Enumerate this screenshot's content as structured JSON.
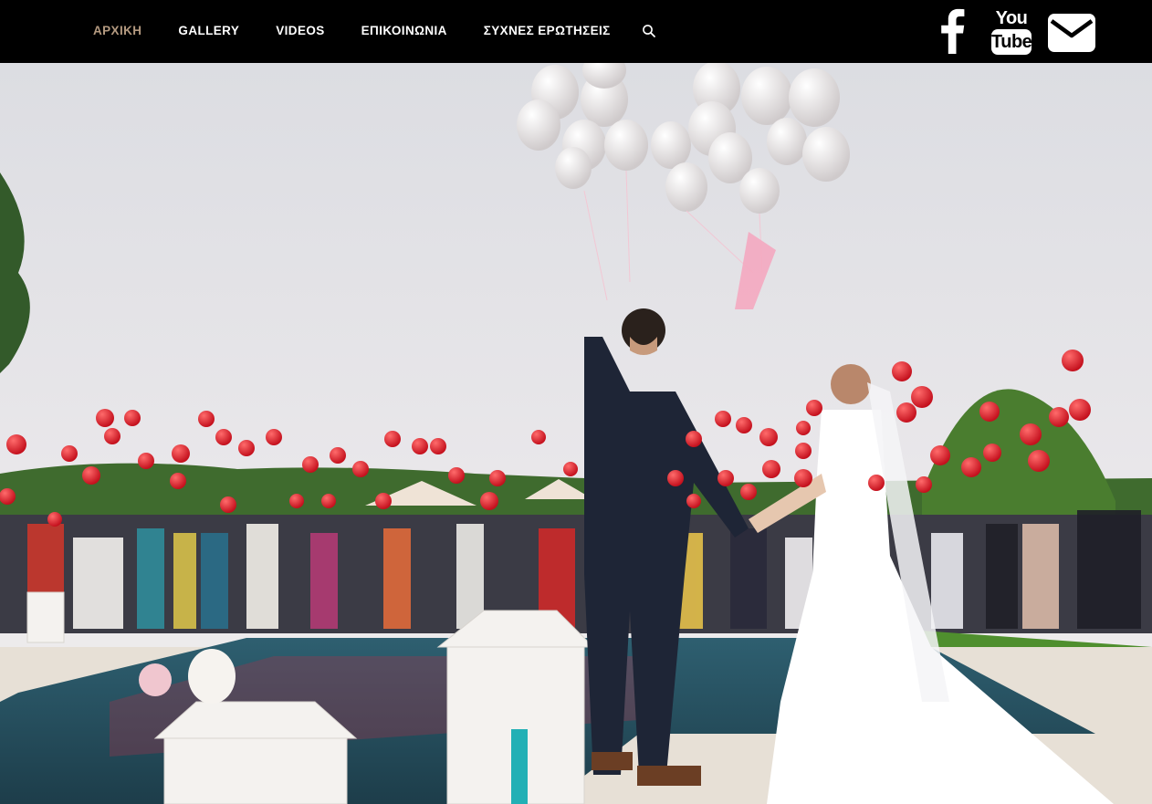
{
  "nav": {
    "items": [
      {
        "label": "ΑΡΧΙΚΗ",
        "active": true
      },
      {
        "label": "GALLERY",
        "active": false
      },
      {
        "label": "VIDEOS",
        "active": false
      },
      {
        "label": "ΕΠΙΚΟΙΝΩΝΙΑ",
        "active": false
      },
      {
        "label": "ΣΥΧΝΕΣ ΕΡΩΤΗΣΕΙΣ",
        "active": false
      }
    ],
    "search_icon": "search-icon"
  },
  "social": {
    "facebook_icon": "facebook-icon",
    "youtube": {
      "icon": "youtube-icon",
      "line1": "You",
      "line2": "Tube"
    },
    "email_icon": "email-icon"
  },
  "colors": {
    "header_bg": "#000000",
    "nav_text": "#ffffff",
    "nav_active": "#b49a80"
  },
  "hero": {
    "image": "wedding-couple-releasing-balloons-photo"
  }
}
